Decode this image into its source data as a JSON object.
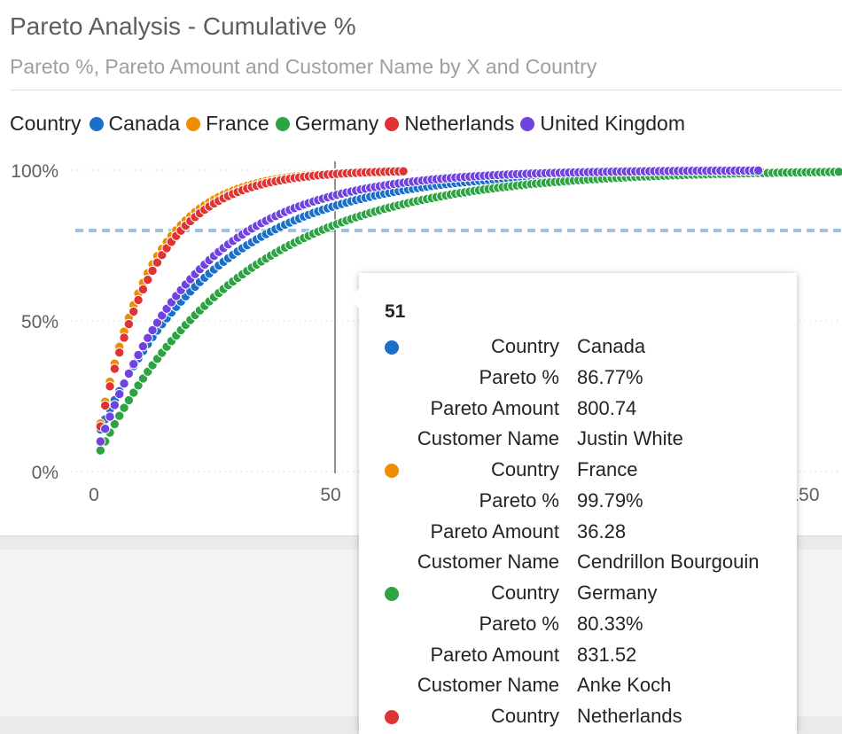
{
  "visual": {
    "title": "Pareto Analysis - Cumulative %",
    "subtitle": "Pareto %, Pareto Amount and Customer Name by X and Country"
  },
  "legend": {
    "title": "Country",
    "items": [
      {
        "label": "Canada",
        "color": "#1a6fc8"
      },
      {
        "label": "France",
        "color": "#ef8c00"
      },
      {
        "label": "Germany",
        "color": "#2ea344"
      },
      {
        "label": "Netherlands",
        "color": "#e03333"
      },
      {
        "label": "United Kingdom",
        "color": "#7043e0"
      }
    ]
  },
  "chart_data": {
    "type": "scatter",
    "x_ticks": [
      "0",
      "50",
      "150"
    ],
    "y_ticks": [
      "100%",
      "50%",
      "0%"
    ],
    "xlim": [
      0,
      157
    ],
    "ylim": [
      0,
      100
    ],
    "reference_line": {
      "y": 80,
      "style": "dashed",
      "color": "#9cc3e5"
    },
    "hover_x": 51,
    "series": [
      {
        "name": "Canada",
        "color": "#1a6fc8",
        "n_points": 140,
        "first_y": 14,
        "rate": 0.04
      },
      {
        "name": "France",
        "color": "#ef8c00",
        "n_points": 60,
        "first_y": 16,
        "rate": 0.09
      },
      {
        "name": "Germany",
        "color": "#2ea344",
        "n_points": 157,
        "first_y": 7,
        "rate": 0.033
      },
      {
        "name": "Netherlands",
        "color": "#e03333",
        "n_points": 65,
        "first_y": 15,
        "rate": 0.085
      },
      {
        "name": "United Kingdom",
        "color": "#7043e0",
        "n_points": 140,
        "first_y": 10,
        "rate": 0.048
      }
    ]
  },
  "tooltip": {
    "header": "51",
    "rows": [
      {
        "color": "#1a6fc8",
        "label": "Country",
        "value": "Canada"
      },
      {
        "label": "Pareto %",
        "value": "86.77%"
      },
      {
        "label": "Pareto Amount",
        "value": "800.74"
      },
      {
        "label": "Customer Name",
        "value": "Justin White"
      },
      {
        "color": "#ef8c00",
        "label": "Country",
        "value": "France"
      },
      {
        "label": "Pareto %",
        "value": "99.79%"
      },
      {
        "label": "Pareto Amount",
        "value": "36.28"
      },
      {
        "label": "Customer Name",
        "value": "Cendrillon Bourgouin"
      },
      {
        "color": "#2ea344",
        "label": "Country",
        "value": "Germany"
      },
      {
        "label": "Pareto %",
        "value": "80.33%"
      },
      {
        "label": "Pareto Amount",
        "value": "831.52"
      },
      {
        "label": "Customer Name",
        "value": "Anke Koch"
      },
      {
        "color": "#e03333",
        "label": "Country",
        "value": "Netherlands"
      }
    ]
  }
}
